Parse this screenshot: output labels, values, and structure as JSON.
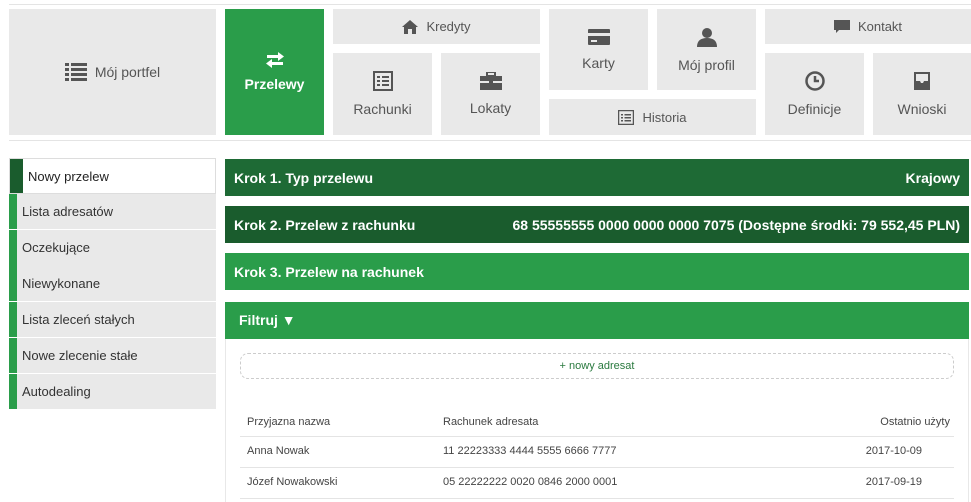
{
  "nav": {
    "portfolio": "Mój portfel",
    "transfers": "Przelewy",
    "credits": "Kredyty",
    "accounts": "Rachunki",
    "deposits": "Lokaty",
    "cards": "Karty",
    "profile": "Mój profil",
    "history": "Historia",
    "contact": "Kontakt",
    "definitions": "Definicje",
    "applications": "Wnioski"
  },
  "sidebar": {
    "items": [
      {
        "label": "Nowy przelew"
      },
      {
        "label": "Lista adresatów"
      },
      {
        "label": "Oczekujące"
      },
      {
        "label": "Niewykonane"
      },
      {
        "label": "Lista zleceń stałych"
      },
      {
        "label": "Nowe zlecenie stałe"
      },
      {
        "label": "Autodealing"
      }
    ]
  },
  "steps": {
    "step1": {
      "label": "Krok 1. Typ przelewu",
      "value": "Krajowy"
    },
    "step2": {
      "label": "Krok 2. Przelew z rachunku",
      "value": "68 55555555 0000 0000 0000 7075 (Dostępne środki: 79 552,45 PLN)"
    },
    "step3": {
      "label": "Krok 3. Przelew na rachunek"
    }
  },
  "filter": {
    "label": "Filtruj ▼"
  },
  "new_recipient": "+ nowy adresat",
  "table": {
    "headers": [
      "Przyjazna nazwa",
      "Rachunek adresata",
      "Ostatnio użyty"
    ],
    "rows": [
      [
        "Anna Nowak",
        "11 22223333 4444 5555 6666 7777",
        "2017-10-09"
      ],
      [
        "Józef Nowakowski",
        "05 22222222 0020 0846 2000 0001",
        "2017-09-19"
      ]
    ]
  },
  "colors": {
    "accent": "#2a9d4a",
    "dark_green": "#1e6a35",
    "tile_bg": "#e9e9e9"
  }
}
